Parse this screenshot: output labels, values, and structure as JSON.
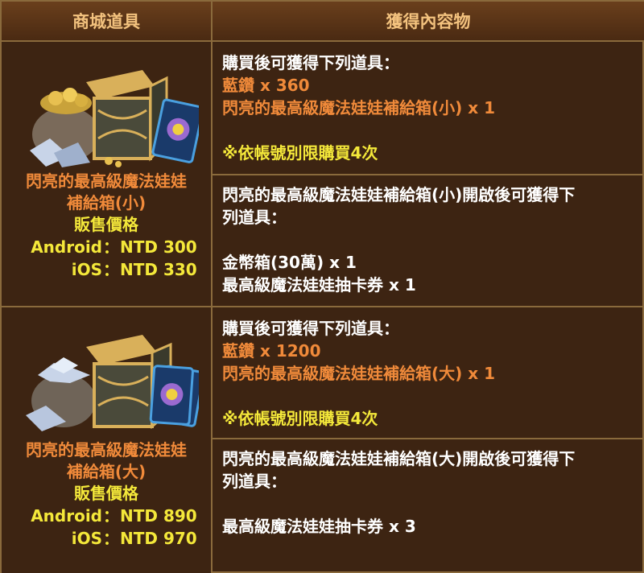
{
  "header": {
    "col1": "商城道具",
    "col2": "獲得內容物"
  },
  "rows": [
    {
      "item": {
        "name_line1": "閃亮的最高級魔法娃娃",
        "name_line2": "補給箱(小)",
        "sale_label": "販售價格",
        "prices": [
          {
            "platform": "Android",
            "sep": "：",
            "value": "NTD 300"
          },
          {
            "platform": "iOS",
            "sep": "：",
            "value": "NTD 330"
          }
        ]
      },
      "purchase": {
        "intro": "購買後可獲得下列道具：",
        "lines": [
          "藍鑽 x 360",
          "閃亮的最高級魔法娃娃補給箱(小) x 1"
        ],
        "limit": "※依帳號別限購買4次"
      },
      "open": {
        "intro_line1": "閃亮的最高級魔法娃娃補給箱(小)開啟後可獲得下",
        "intro_line2": "列道具：",
        "items": [
          "金幣箱(30萬) x 1",
          "最高級魔法娃娃抽卡券 x 1"
        ]
      }
    },
    {
      "item": {
        "name_line1": "閃亮的最高級魔法娃娃",
        "name_line2": "補給箱(大)",
        "sale_label": "販售價格",
        "prices": [
          {
            "platform": "Android",
            "sep": "：",
            "value": "NTD 890"
          },
          {
            "platform": "iOS",
            "sep": "：",
            "value": "NTD 970"
          }
        ]
      },
      "purchase": {
        "intro": "購買後可獲得下列道具：",
        "lines": [
          "藍鑽 x 1200",
          "閃亮的最高級魔法娃娃補給箱(大) x 1"
        ],
        "limit": "※依帳號別限購買4次"
      },
      "open": {
        "intro_line1": "閃亮的最高級魔法娃娃補給箱(大)開啟後可獲得下",
        "intro_line2": "列道具：",
        "items": [
          "最高級魔法娃娃抽卡券 x 3"
        ]
      }
    }
  ],
  "colors": {
    "orange": "#f08a3a",
    "yellow": "#f4e83a",
    "border": "#8a6a3c",
    "background": "#3d2412"
  }
}
